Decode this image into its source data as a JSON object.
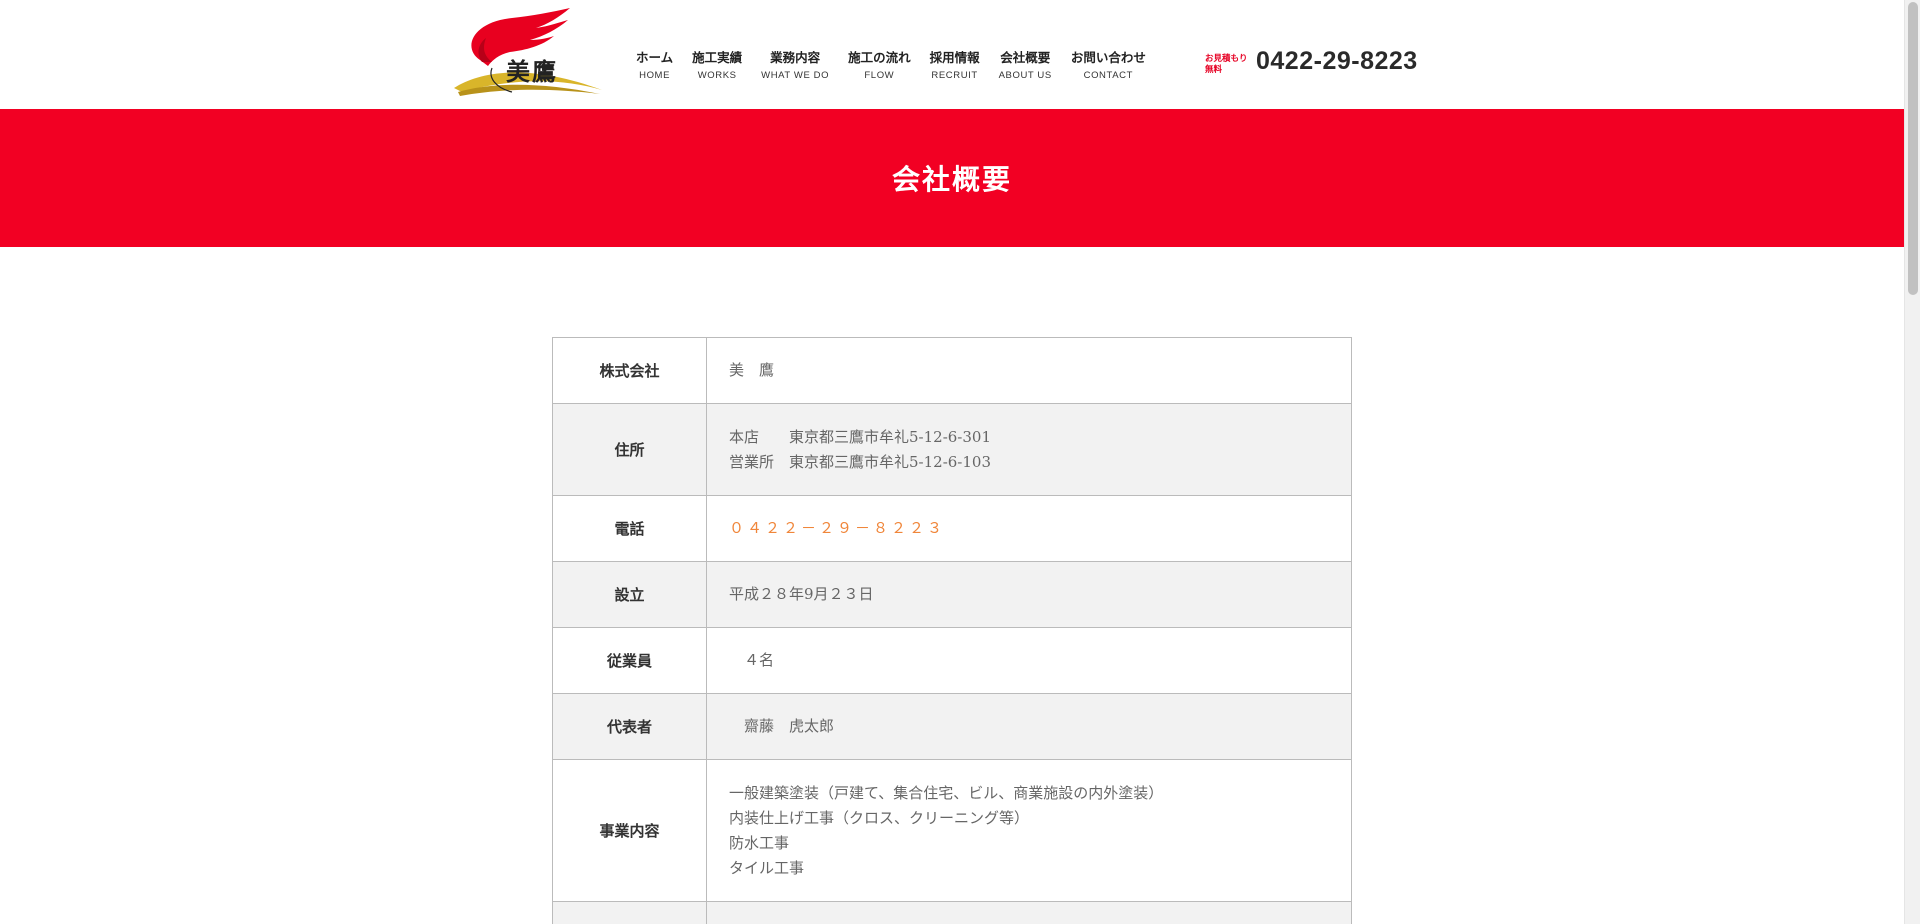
{
  "header": {
    "logo_text": "美鷹",
    "nav": [
      {
        "jp": "ホーム",
        "en": "HOME"
      },
      {
        "jp": "施工実績",
        "en": "WORKS"
      },
      {
        "jp": "業務内容",
        "en": "WHAT WE DO"
      },
      {
        "jp": "施工の流れ",
        "en": "FLOW"
      },
      {
        "jp": "採用情報",
        "en": "RECRUIT"
      },
      {
        "jp": "会社概要",
        "en": "ABOUT US"
      },
      {
        "jp": "お問い合わせ",
        "en": "CONTACT"
      }
    ],
    "free_quote": "お見積もり無料",
    "phone": "0422-29-8223"
  },
  "banner": {
    "title": "会社概要"
  },
  "company": {
    "rows": [
      {
        "label": "株式会社",
        "lines": [
          "美　鷹"
        ]
      },
      {
        "label": "住所",
        "lines": [
          "本店　　東京都三鷹市牟礼5-12-6-301",
          "営業所　東京都三鷹市牟礼5-12-6-103"
        ]
      },
      {
        "label": "電話",
        "lines": [
          "０４２２－２９－８２２３"
        ]
      },
      {
        "label": "設立",
        "lines": [
          "平成２８年9月２３日"
        ]
      },
      {
        "label": "従業員",
        "lines": [
          "　４名"
        ]
      },
      {
        "label": "代表者",
        "lines": [
          "　齋藤　虎太郎"
        ]
      },
      {
        "label": "事業内容",
        "lines": [
          "一般建築塗装（戸建て、集合住宅、ビル、商業施設の内外塗装）",
          "内装仕上げ工事（クロス、クリーニング等）",
          "防水工事",
          "タイル工事"
        ]
      }
    ]
  },
  "colors": {
    "brand_red": "#f20023",
    "tel_orange": "#f0863a",
    "row_alt_bg": "#f2f2f2"
  },
  "icons": {
    "logo": "eagle-wing-logo-icon"
  }
}
